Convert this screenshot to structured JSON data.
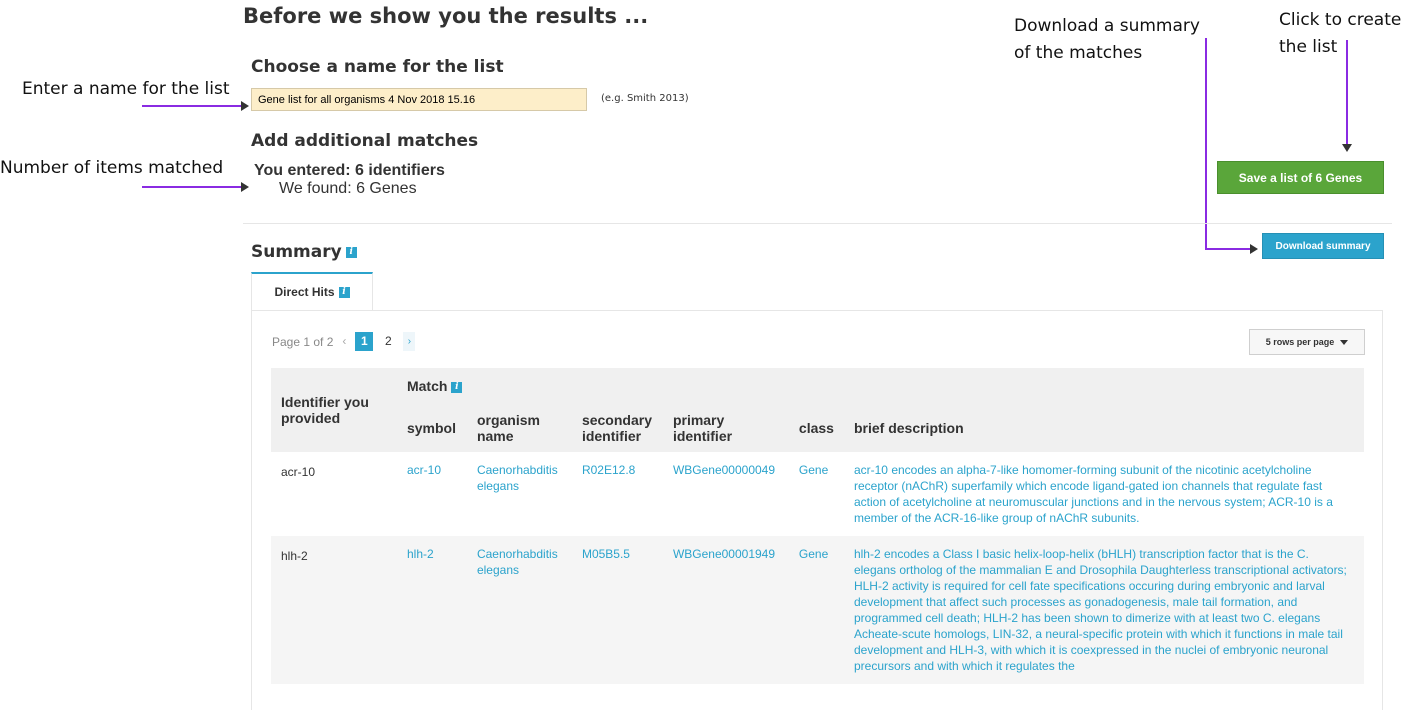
{
  "page": {
    "title": "Before we show you the results ..."
  },
  "annotations": {
    "enter_name": "Enter a name for the list",
    "items_matched": "Number of items matched",
    "download_line1": "Download a summary",
    "download_line2": "of the matches",
    "create_line1": "Click to create",
    "create_line2": "the list"
  },
  "list_name": {
    "heading": "Choose a name for the list",
    "value": "Gene list for all organisms 4 Nov 2018 15.16",
    "example": "(e.g. Smith 2013)"
  },
  "additional": {
    "heading": "Add additional matches",
    "entered": "You entered: 6 identifiers",
    "found": "We found: 6 Genes"
  },
  "actions": {
    "save_label": "Save a list of 6 Genes",
    "download_label": "Download summary"
  },
  "summary": {
    "heading": "Summary",
    "tab_label": "Direct Hits"
  },
  "pager": {
    "label": "Page 1 of 2",
    "prev": "‹",
    "next": "›",
    "pages": [
      "1",
      "2"
    ],
    "rows_per_page": "5 rows per page"
  },
  "table": {
    "identifier_header": "Identifier you provided",
    "match_header": "Match",
    "columns": [
      "symbol",
      "organism name",
      "secondary identifier",
      "primary identifier",
      "class",
      "brief description"
    ],
    "rows": [
      {
        "identifier": "acr-10",
        "symbol": "acr-10",
        "organism": "Caenorhabditis elegans",
        "secondary": "R02E12.8",
        "primary": "WBGene00000049",
        "class": "Gene",
        "description": "acr-10 encodes an alpha-7-like homomer-forming subunit of the nicotinic acetylcholine receptor (nAChR) superfamily which encode ligand-gated ion channels that regulate fast action of acetylcholine at neuromuscular junctions and in the nervous system; ACR-10 is a member of the ACR-16-like group of nAChR subunits."
      },
      {
        "identifier": "hlh-2",
        "symbol": "hlh-2",
        "organism": "Caenorhabditis elegans",
        "secondary": "M05B5.5",
        "primary": "WBGene00001949",
        "class": "Gene",
        "description": "hlh-2 encodes a Class I basic helix-loop-helix (bHLH) transcription factor that is the C. elegans ortholog of the mammalian E and Drosophila Daughterless transcriptional activators; HLH-2 activity is required for cell fate specifications occuring during embryonic and larval development that affect such processes as gonadogenesis, male tail formation, and programmed cell death; HLH-2 has been shown to dimerize with at least two C. elegans Acheate-scute homologs, LIN-32, a neural-specific protein with which it functions in male tail development and HLH-3, with which it is coexpressed in the nuclei of embryonic neuronal precursors and with which it regulates the"
      }
    ]
  },
  "colors": {
    "accent": "#2ba3cc",
    "save_button": "#5aa63a",
    "input_bg": "#fdeec9",
    "annotation_line": "#8a2be2"
  }
}
